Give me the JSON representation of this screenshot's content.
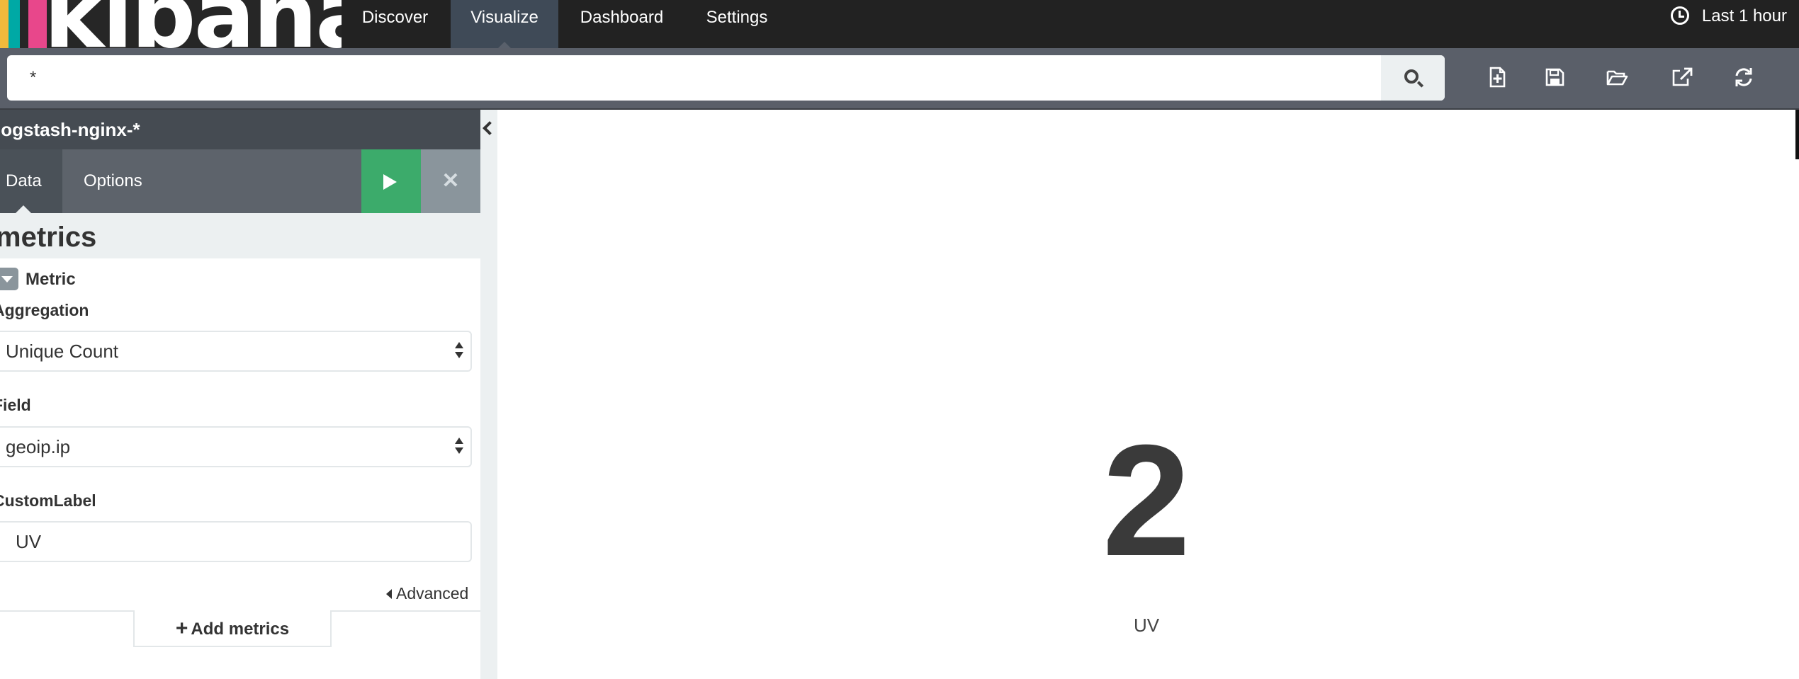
{
  "app": {
    "logo_text": "kibana",
    "logo_colors": [
      "#f1b93c",
      "#00a9a5",
      "#e8478b"
    ]
  },
  "nav": {
    "items": [
      {
        "label": "Discover"
      },
      {
        "label": "Visualize"
      },
      {
        "label": "Dashboard"
      },
      {
        "label": "Settings"
      }
    ],
    "active": "Visualize",
    "time_range": "Last 1 hour",
    "clock_icon": "clock-icon"
  },
  "query": {
    "value": "*",
    "search_icon": "search-icon",
    "toolbar_icons": [
      "new-visualization-icon",
      "save-icon",
      "open-icon",
      "share-icon",
      "refresh-icon"
    ]
  },
  "sidebar": {
    "index_pattern": "logstash-nginx-*",
    "tabs": [
      {
        "label": "Data"
      },
      {
        "label": "Options"
      }
    ],
    "apply_icon": "play-icon",
    "discard_icon": "close-icon",
    "section_title": "metrics",
    "metric": {
      "title": "Metric",
      "aggregation_label": "Aggregation",
      "aggregation_value": "Unique Count",
      "field_label": "Field",
      "field_value": "geoip.ip",
      "custom_label_label": "CustomLabel",
      "custom_label_value": "UV",
      "advanced_label": "Advanced"
    },
    "add_metrics_label": "Add metrics"
  },
  "visualization": {
    "value": "2",
    "label": "UV"
  },
  "colors": {
    "nav_bg": "#222222",
    "nav_active": "#3f4a57",
    "query_bar": "#5a5f69",
    "apply_green": "#3cab6b",
    "discard_gray": "#8a959c",
    "panel_bg": "#ecf0f1"
  }
}
